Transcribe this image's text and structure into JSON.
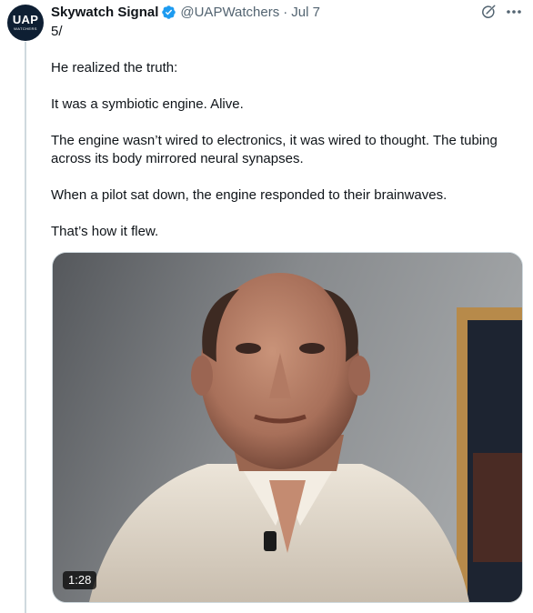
{
  "account": {
    "avatar_text": "UAP",
    "avatar_subtext": "WATCHERS",
    "display_name": "Skywatch Signal",
    "handle": "@UAPWatchers",
    "separator": "·",
    "date": "Jul 7",
    "verified": true
  },
  "post": {
    "thread_number": "5/",
    "paragraphs": [
      "He realized the truth:",
      "It was a symbiotic engine. Alive.",
      "The engine wasn’t wired to electronics, it was wired to thought. The tubing across its body mirrored neural synapses.",
      "When a pilot sat down, the engine responded to their brainwaves.",
      "That’s how it flew."
    ]
  },
  "media": {
    "type": "video",
    "duration": "1:28"
  },
  "icons": {
    "verified": "verified-badge-icon",
    "grok": "grok-icon",
    "more": "more-options-icon"
  },
  "colors": {
    "verified_blue": "#1d9bf0",
    "secondary_text": "#536471",
    "primary_text": "#0f1419",
    "thread_line": "#cfd9de"
  }
}
